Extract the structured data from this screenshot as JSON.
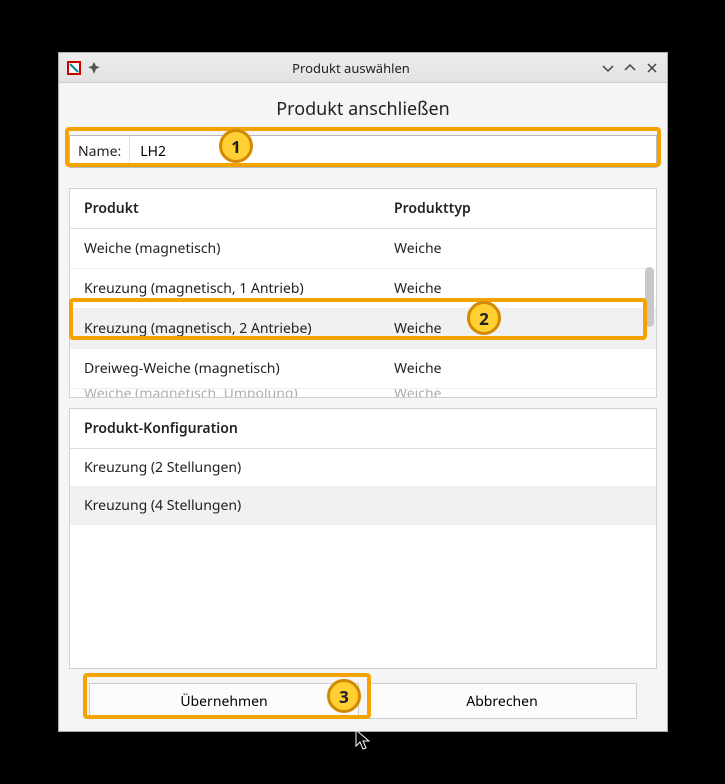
{
  "titlebar": {
    "title": "Produkt auswählen"
  },
  "heading": "Produkt anschließen",
  "name": {
    "label": "Name:",
    "value": "LH2"
  },
  "table": {
    "headers": {
      "product": "Produkt",
      "type": "Produkttyp"
    },
    "rows": [
      {
        "product": "Weiche (magnetisch)",
        "type": "Weiche",
        "selected": false
      },
      {
        "product": "Kreuzung (magnetisch, 1 Antrieb)",
        "type": "Weiche",
        "selected": false
      },
      {
        "product": "Kreuzung (magnetisch, 2 Antriebe)",
        "type": "Weiche",
        "selected": true
      },
      {
        "product": "Dreiweg-Weiche (magnetisch)",
        "type": "Weiche",
        "selected": false
      },
      {
        "product": "Weiche (magnetisch, Umpolung)",
        "type": "Weiche",
        "selected": false
      }
    ]
  },
  "config": {
    "header": "Produkt-Konfiguration",
    "rows": [
      {
        "label": "Kreuzung (2 Stellungen)",
        "selected": false
      },
      {
        "label": "Kreuzung (4 Stellungen)",
        "selected": true
      }
    ]
  },
  "buttons": {
    "apply": "Übernehmen",
    "cancel": "Abbrechen"
  },
  "annotations": {
    "a1": "1",
    "a2": "2",
    "a3": "3"
  }
}
